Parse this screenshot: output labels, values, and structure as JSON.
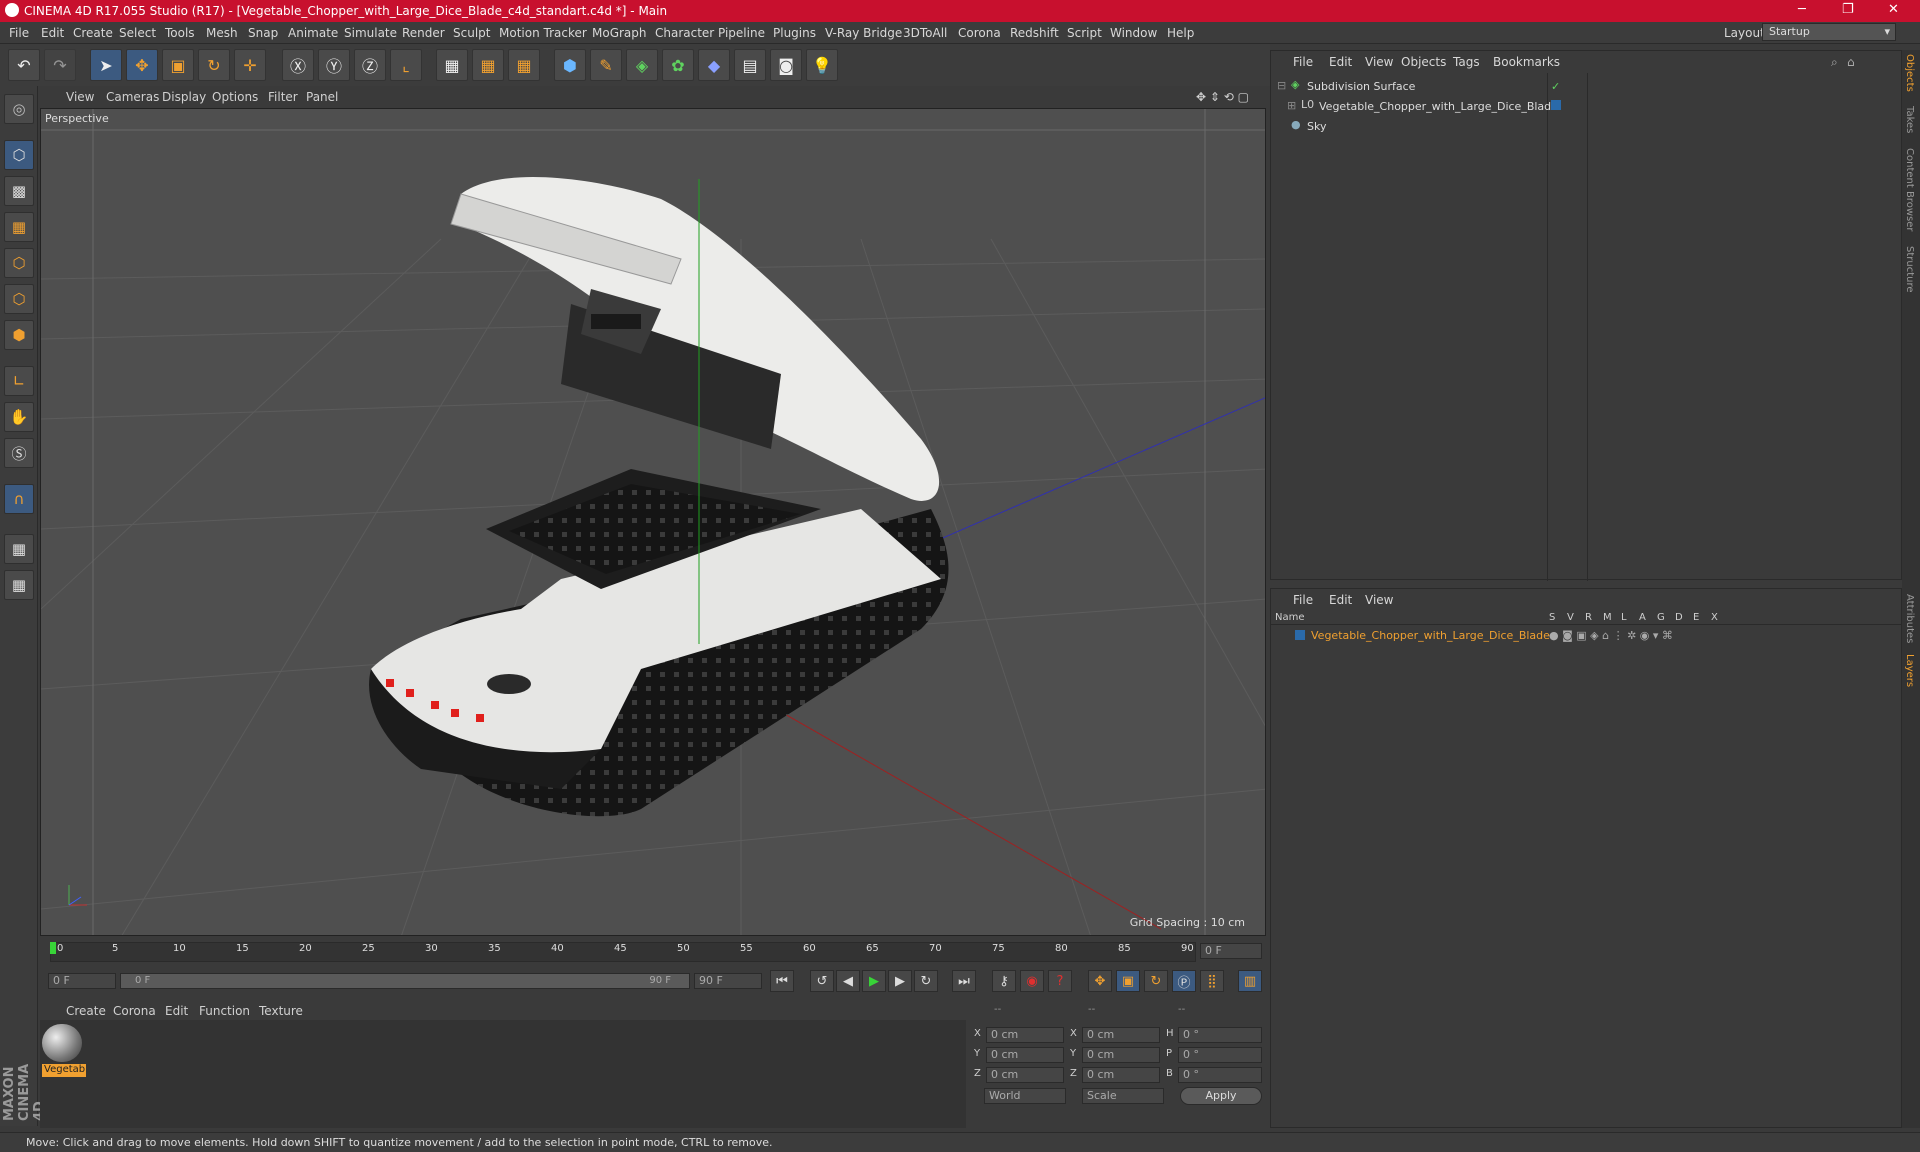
{
  "titlebar": {
    "title": "CINEMA 4D R17.055 Studio (R17) - [Vegetable_Chopper_with_Large_Dice_Blade_c4d_standart.c4d *] - Main",
    "minimize": "─",
    "maximize": "❐",
    "close": "✕"
  },
  "menu": [
    "File",
    "Edit",
    "Create",
    "Select",
    "Tools",
    "Mesh",
    "Snap",
    "Animate",
    "Simulate",
    "Render",
    "Sculpt",
    "Motion Tracker",
    "MoGraph",
    "Character",
    "Pipeline",
    "Plugins",
    "V-Ray Bridge",
    "3DToAll",
    "Corona",
    "Redshift",
    "Script",
    "Window",
    "Help"
  ],
  "layout": {
    "label": "Layout:",
    "value": "Startup"
  },
  "viewport": {
    "menu": [
      "View",
      "Cameras",
      "Display",
      "Options",
      "Filter",
      "Panel"
    ],
    "label": "Perspective",
    "grid_spacing": "Grid Spacing : 10 cm"
  },
  "timeline": {
    "ticks": [
      "0",
      "5",
      "10",
      "15",
      "20",
      "25",
      "30",
      "35",
      "40",
      "45",
      "50",
      "55",
      "60",
      "65",
      "70",
      "75",
      "80",
      "85",
      "90"
    ],
    "current_frame": "0 F"
  },
  "transport": {
    "start": "0 F",
    "slider_start": "0 F",
    "slider_end": "90 F",
    "end": "90 F"
  },
  "material_menu": [
    "Create",
    "Corona",
    "Edit",
    "Function",
    "Texture"
  ],
  "material": {
    "name": "Vegetab"
  },
  "coords": {
    "header": [
      "--",
      "--",
      "--"
    ],
    "rows": [
      {
        "a": "X",
        "av": "0 cm",
        "b": "X",
        "bv": "0 cm",
        "c": "H",
        "cv": "0 °"
      },
      {
        "a": "Y",
        "av": "0 cm",
        "b": "Y",
        "bv": "0 cm",
        "c": "P",
        "cv": "0 °"
      },
      {
        "a": "Z",
        "av": "0 cm",
        "b": "Z",
        "bv": "0 cm",
        "c": "B",
        "cv": "0 °"
      }
    ],
    "mode": "World",
    "scale": "Scale",
    "apply": "Apply"
  },
  "objects": {
    "menu": [
      "File",
      "Edit",
      "View",
      "Objects",
      "Tags",
      "Bookmarks"
    ],
    "items": [
      "Subdivision Surface",
      "Vegetable_Chopper_with_Large_Dice_Blade",
      "Sky"
    ]
  },
  "layers": {
    "menu": [
      "File",
      "Edit",
      "View"
    ],
    "name_header": "Name",
    "cols": [
      "S",
      "V",
      "R",
      "M",
      "L",
      "A",
      "G",
      "D",
      "E",
      "X"
    ],
    "item": "Vegetable_Chopper_with_Large_Dice_Blade"
  },
  "side_tabs": [
    "Objects",
    "Takes",
    "Content Browser",
    "Structure",
    "Attributes",
    "Layers"
  ],
  "brand": "MAXON CINEMA 4D",
  "status": "Move: Click and drag to move elements. Hold down SHIFT to quantize movement / add to the selection in point mode, CTRL to remove.",
  "colors": {
    "titlebar": "#c8102e",
    "accent": "#f0a030",
    "selection": "#3c5a80"
  }
}
